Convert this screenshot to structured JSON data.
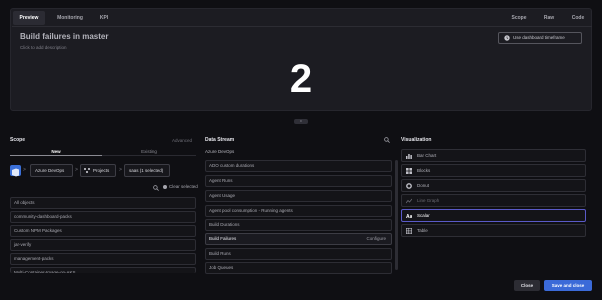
{
  "top": {
    "tabs": [
      {
        "label": "Preview"
      },
      {
        "label": "Monitoring"
      },
      {
        "label": "KPI"
      },
      {
        "label": "Scope"
      },
      {
        "label": "Raw"
      },
      {
        "label": "Code"
      }
    ],
    "active_tab": "Preview",
    "widget_title": "Build failures in master",
    "widget_description": "Click to add description",
    "timeframe_button": "Use dashboard timeframe",
    "big_value": "2",
    "collapse_label": "≡"
  },
  "scope": {
    "title": "Scope",
    "advanced_label": "Advanced",
    "segments": [
      "New",
      "Existing"
    ],
    "chips": {
      "azure": "Azure DevOps",
      "projects": "Projects",
      "saas": "saas (1 selected)",
      "separator": ">"
    },
    "clear_selected": "Clear selected",
    "items": [
      "All objects",
      "community-dashboard-packs",
      "Custom NPM Packages",
      "jar-verify",
      "management-packs",
      "Multi-Container-Image-on-AKS"
    ]
  },
  "data_stream": {
    "title": "Data Stream",
    "subtitle": "Azure DevOps",
    "configure_label": "Configure",
    "selected_item": "Build Failures",
    "items": [
      "ADO custom durations",
      "Agent Runs",
      "Agent Usage",
      "Agent pool consumption - Running agents",
      "Build Durations",
      "Build Failures",
      "Build Runs",
      "Job Queues"
    ]
  },
  "visualization": {
    "title": "Visualization",
    "selected": "Scalar",
    "items": [
      {
        "label": "Bar Chart",
        "icon": "bar-chart-icon"
      },
      {
        "label": "Blocks",
        "icon": "blocks-icon"
      },
      {
        "label": "Donut",
        "icon": "donut-icon"
      },
      {
        "label": "Line Graph",
        "icon": "line-graph-icon"
      },
      {
        "label": "Scalar",
        "icon": "scalar-icon"
      },
      {
        "label": "Table",
        "icon": "table-icon"
      }
    ]
  },
  "footer": {
    "close_label": "Close",
    "save_label": "Save and close"
  },
  "colors": {
    "accent": "#3b6ad8",
    "background": "#0f0f13",
    "panel": "#1c1c22"
  }
}
